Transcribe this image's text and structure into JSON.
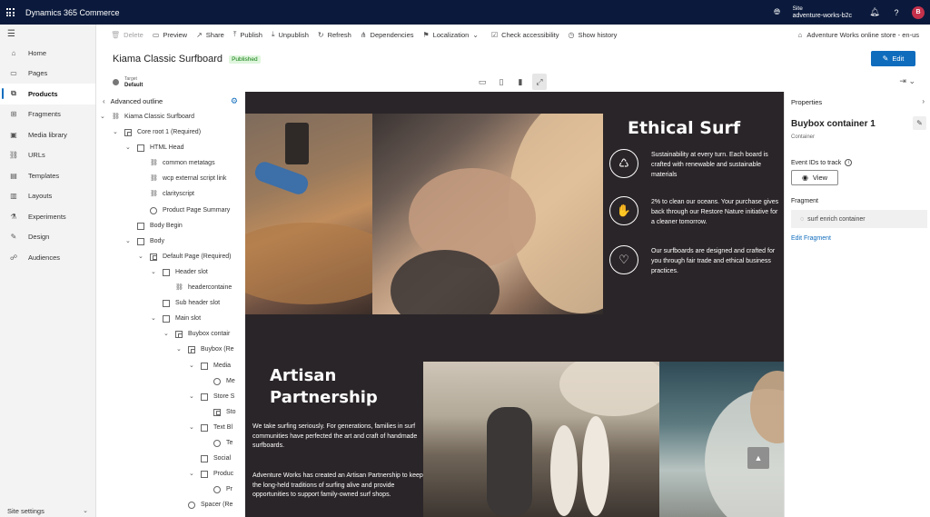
{
  "app": {
    "title": "Dynamics 365 Commerce"
  },
  "site": {
    "label": "Site",
    "value": "adventure-works-b2c"
  },
  "user": {
    "initial": "B"
  },
  "nav": {
    "items": [
      {
        "label": "Home",
        "icon": "home-icon",
        "glyph": "⌂",
        "active": false
      },
      {
        "label": "Pages",
        "icon": "page-icon",
        "glyph": "▭",
        "active": false
      },
      {
        "label": "Products",
        "icon": "products-icon",
        "glyph": "⧉",
        "active": true
      },
      {
        "label": "Fragments",
        "icon": "fragments-icon",
        "glyph": "⊞",
        "active": false
      },
      {
        "label": "Media library",
        "icon": "media-icon",
        "glyph": "▣",
        "active": false
      },
      {
        "label": "URLs",
        "icon": "link-icon",
        "glyph": "⛓",
        "active": false
      },
      {
        "label": "Templates",
        "icon": "templates-icon",
        "glyph": "▤",
        "active": false
      },
      {
        "label": "Layouts",
        "icon": "layouts-icon",
        "glyph": "▥",
        "active": false
      },
      {
        "label": "Experiments",
        "icon": "flask-icon",
        "glyph": "⚗",
        "active": false
      },
      {
        "label": "Design",
        "icon": "brush-icon",
        "glyph": "✎",
        "active": false
      },
      {
        "label": "Audiences",
        "icon": "audiences-icon",
        "glyph": "☍",
        "active": false
      }
    ],
    "settings_label": "Site settings"
  },
  "toolbar": {
    "delete": "Delete",
    "preview": "Preview",
    "share": "Share",
    "publish": "Publish",
    "unpublish": "Unpublish",
    "refresh": "Refresh",
    "dependencies": "Dependencies",
    "localization": "Localization",
    "check_accessibility": "Check accessibility",
    "show_history": "Show history",
    "store": "Adventure Works online store - en-us"
  },
  "page": {
    "title": "Kiama Classic Surfboard",
    "status": "Published",
    "edit_label": "Edit",
    "target_label": "Target",
    "target_value": "Default"
  },
  "outline": {
    "title": "Advanced outline",
    "rows": [
      {
        "label": "Kiama Classic Surfboard",
        "indent": 0,
        "chev": "⌄",
        "marker": "module"
      },
      {
        "label": "Core root 1 (Required)",
        "indent": 1,
        "chev": "⌄",
        "marker": "box-inner"
      },
      {
        "label": "HTML Head",
        "indent": 2,
        "chev": "⌄",
        "marker": "box"
      },
      {
        "label": "common metatags",
        "indent": 3,
        "chev": "",
        "marker": "module"
      },
      {
        "label": "wcp external script link",
        "indent": 3,
        "chev": "",
        "marker": "module"
      },
      {
        "label": "clarityscript",
        "indent": 3,
        "chev": "",
        "marker": "module"
      },
      {
        "label": "Product Page Summary",
        "indent": 3,
        "chev": "",
        "marker": "circle"
      },
      {
        "label": "Body Begin",
        "indent": 2,
        "chev": "",
        "marker": "box"
      },
      {
        "label": "Body",
        "indent": 2,
        "chev": "⌄",
        "marker": "box"
      },
      {
        "label": "Default Page (Required)",
        "indent": 3,
        "chev": "⌄",
        "marker": "box-inner"
      },
      {
        "label": "Header slot",
        "indent": 4,
        "chev": "⌄",
        "marker": "box"
      },
      {
        "label": "headercontaine",
        "indent": 5,
        "chev": "",
        "marker": "module"
      },
      {
        "label": "Sub header slot",
        "indent": 4,
        "chev": "",
        "marker": "box"
      },
      {
        "label": "Main slot",
        "indent": 4,
        "chev": "⌄",
        "marker": "box"
      },
      {
        "label": "Buybox contair",
        "indent": 5,
        "chev": "⌄",
        "marker": "box-inner"
      },
      {
        "label": "Buybox (Re",
        "indent": 6,
        "chev": "⌄",
        "marker": "box-inner"
      },
      {
        "label": "Media",
        "indent": 7,
        "chev": "⌄",
        "marker": "box"
      },
      {
        "label": "Me",
        "indent": 8,
        "chev": "",
        "marker": "circle"
      },
      {
        "label": "Store S",
        "indent": 7,
        "chev": "⌄",
        "marker": "box"
      },
      {
        "label": "Sto",
        "indent": 8,
        "chev": "",
        "marker": "box-inner"
      },
      {
        "label": "Text Bl",
        "indent": 7,
        "chev": "⌄",
        "marker": "box"
      },
      {
        "label": "Te",
        "indent": 8,
        "chev": "",
        "marker": "circle"
      },
      {
        "label": "Social",
        "indent": 7,
        "chev": "",
        "marker": "box"
      },
      {
        "label": "Produc",
        "indent": 7,
        "chev": "⌄",
        "marker": "box"
      },
      {
        "label": "Pr",
        "indent": 8,
        "chev": "",
        "marker": "circle"
      },
      {
        "label": "Spacer (Re",
        "indent": 6,
        "chev": "",
        "marker": "circle"
      }
    ]
  },
  "canvas": {
    "ethical": {
      "title": "Ethical Surf",
      "features": [
        {
          "icon": "globe-leaf-icon",
          "glyph": "♺",
          "text": "Sustainability at every turn. Each board is crafted with renewable and sustainable materials"
        },
        {
          "icon": "hand-ocean-icon",
          "glyph": "✋",
          "text": "2% to clean our oceans. Your purchase gives back through our Restore Nature initiative for a cleaner tomorrow."
        },
        {
          "icon": "hand-heart-icon",
          "glyph": "♡",
          "text": "Our surfboards are designed and crafted for you through fair trade and ethical business practices."
        }
      ]
    },
    "artisan": {
      "title": "Artisan Partnership",
      "p1": "We take surfing seriously. For generations, families in surf communities have perfected the art and craft of handmade surfboards.",
      "p2": "Adventure Works has created an Artisan Partnership to keep the long-held traditions of surfing alive and provide opportunities to support family-owned surf shops."
    }
  },
  "properties": {
    "title": "Properties",
    "component_name": "Buybox container 1",
    "component_type": "Container",
    "events_label": "Event IDs to track",
    "view_label": "View",
    "fragment_label": "Fragment",
    "fragment_value": "surf enrich container",
    "edit_fragment": "Edit Fragment"
  },
  "colors": {
    "topbar": "#0b1a3c",
    "accent": "#0f6cbd",
    "canvas": "#2a2528",
    "published_badge": "#dff6dd"
  }
}
